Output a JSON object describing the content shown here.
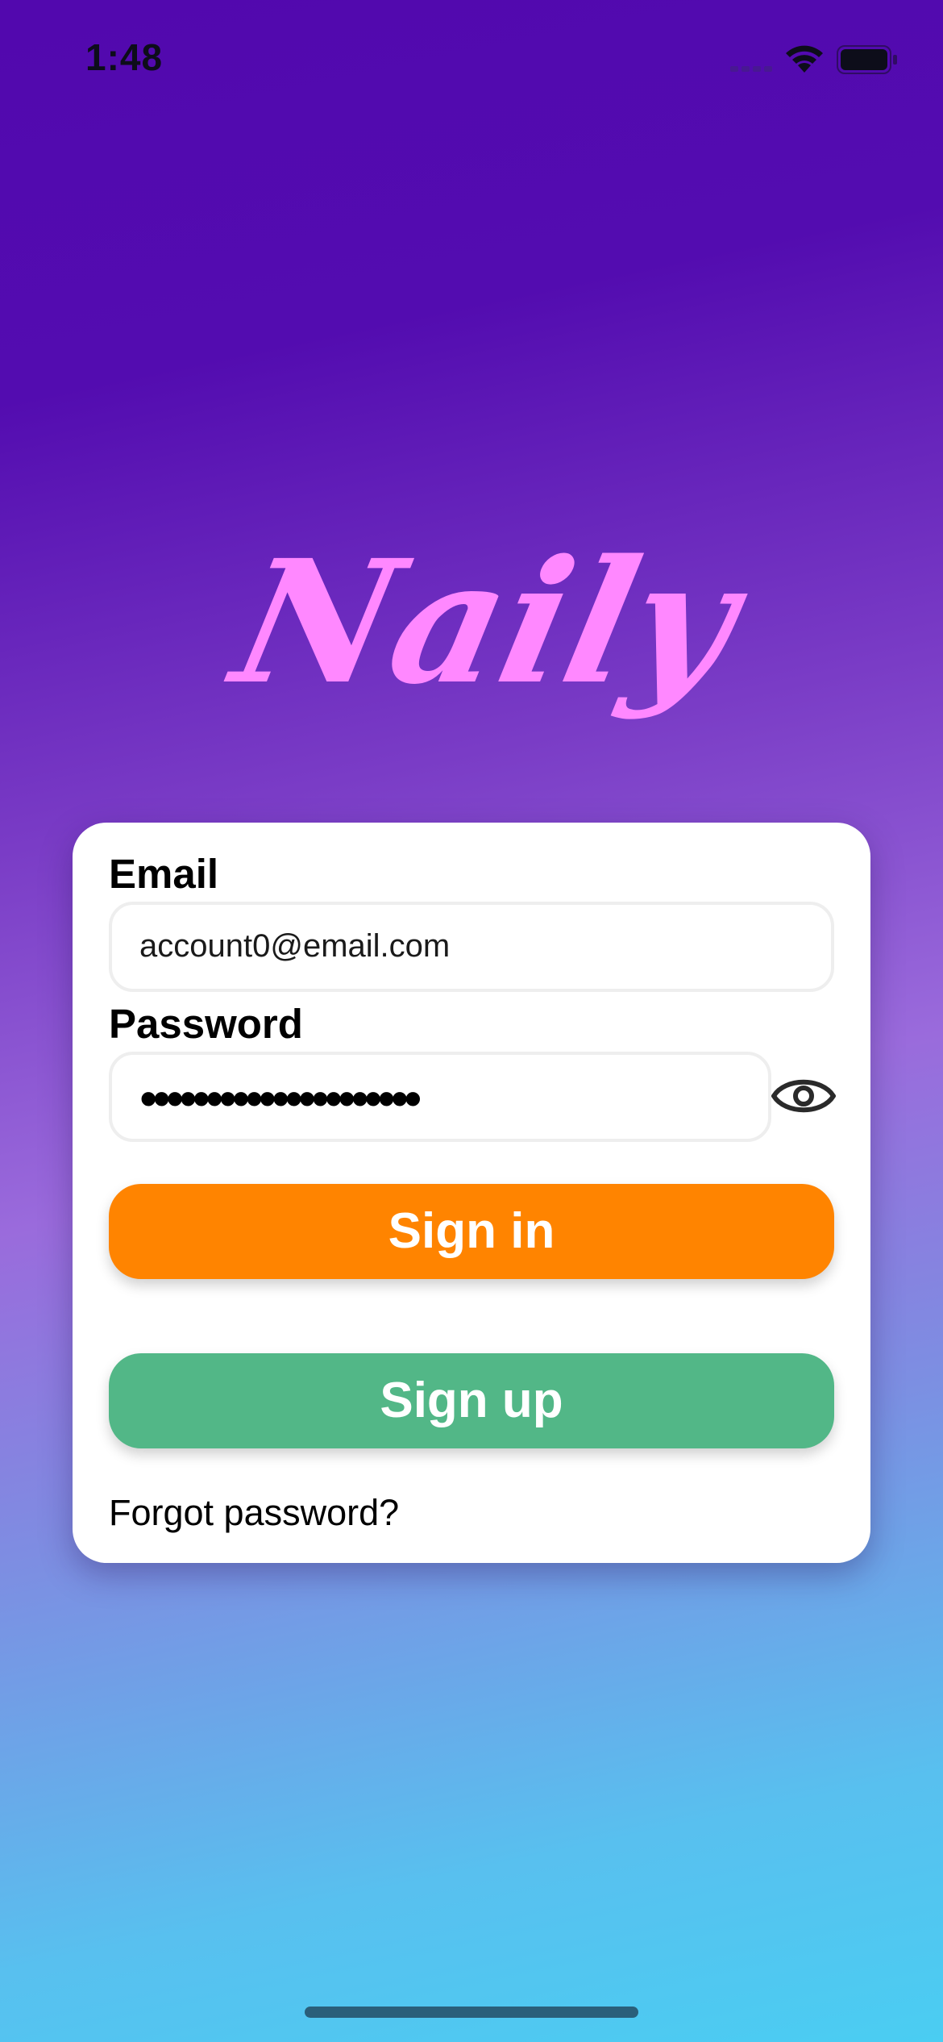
{
  "status_bar": {
    "time": "1:48",
    "signal_icon": "cellular-signal-icon",
    "wifi_icon": "wifi-icon",
    "battery_icon": "battery-icon"
  },
  "logo": {
    "text": "Naily",
    "color": "#ff88ff"
  },
  "login_form": {
    "email_label": "Email",
    "email_value": "account0@email.com",
    "password_label": "Password",
    "password_value": "•••••••••••••••••••••",
    "show_password_icon": "eye-icon",
    "sign_in_label": "Sign in",
    "sign_up_label": "Sign up",
    "forgot_password_label": "Forgot password?"
  },
  "colors": {
    "background_top": "#5208ae",
    "background_bottom": "#4acdf2",
    "sign_in_button": "#ff8400",
    "sign_up_button": "#52b787",
    "card": "#ffffff"
  }
}
